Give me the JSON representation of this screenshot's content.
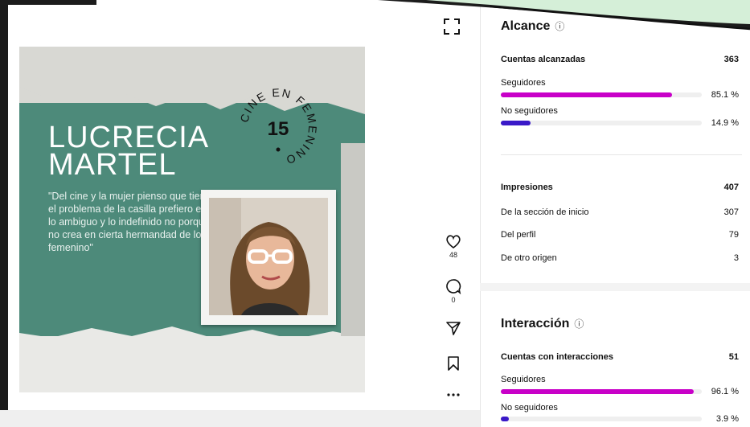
{
  "poster": {
    "title": "LUCRECIA\nMARTEL",
    "quote": "\"Del cine y la mujer pienso que tiene el problema de la casilla prefiero en lo ambiguo y lo indefinido no porque no crea en cierta hermandad de lo femenino\"",
    "badge_text": "CINE EN FEMENINO",
    "badge_number": "15"
  },
  "actions": {
    "likes": "48",
    "comments": "0"
  },
  "alcance": {
    "title": "Alcance",
    "info_icon": "ⓘ",
    "accounts_label": "Cuentas alcanzadas",
    "accounts_value": "363",
    "followers_label": "Seguidores",
    "followers_pct": "85.1 %",
    "followers_fraction": 0.851,
    "nonfollowers_label": "No seguidores",
    "nonfollowers_pct": "14.9 %",
    "nonfollowers_fraction": 0.149
  },
  "impresiones": {
    "label": "Impresiones",
    "value": "407",
    "rows": [
      {
        "label": "De la sección de inicio",
        "value": "307"
      },
      {
        "label": "Del perfil",
        "value": "79"
      },
      {
        "label": "De otro origen",
        "value": "3"
      }
    ]
  },
  "interaccion": {
    "title": "Interacción",
    "info_icon": "ⓘ",
    "accounts_label": "Cuentas con interacciones",
    "accounts_value": "51",
    "followers_label": "Seguidores",
    "followers_pct": "96.1 %",
    "followers_fraction": 0.961,
    "nonfollowers_label": "No seguidores",
    "nonfollowers_pct": "3.9 %",
    "nonfollowers_fraction": 0.039
  },
  "colors": {
    "followers_bar": "#c800c8",
    "nonfollowers_bar": "#3a19c8",
    "poster_green": "#4d8a7a"
  }
}
